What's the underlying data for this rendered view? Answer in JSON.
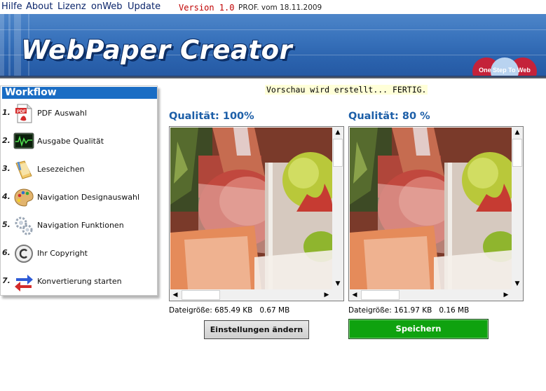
{
  "menu": {
    "items": [
      "Hilfe",
      "About",
      "Lizenz",
      "onWeb",
      "Update"
    ],
    "version": "Version 1.0",
    "edition_info": "PROF. vom 18.11.2009"
  },
  "banner": {
    "title": "WebPaper Creator",
    "partner_logo_text": "One Step To Web"
  },
  "workflow": {
    "title": "Workflow",
    "items": [
      {
        "num": "1.",
        "label": "PDF Auswahl",
        "icon": "pdf-icon"
      },
      {
        "num": "2.",
        "label": "Ausgabe Qualität",
        "icon": "monitor-chart-icon"
      },
      {
        "num": "3.",
        "label": "Lesezeichen",
        "icon": "bookmark-icon"
      },
      {
        "num": "4.",
        "label": "Navigation Designauswahl",
        "icon": "palette-icon"
      },
      {
        "num": "5.",
        "label": "Navigation Funktionen",
        "icon": "gears-icon"
      },
      {
        "num": "6.",
        "label": "Ihr Copyright",
        "icon": "copyright-icon"
      },
      {
        "num": "7.",
        "label": "Konvertierung starten",
        "icon": "convert-arrows-icon"
      }
    ]
  },
  "status": "Vorschau wird erstellt... FERTIG.",
  "preview_left": {
    "title": "Qualität: 100%",
    "filesize_label": "Dateigröße: 685.49 KB",
    "filesize_mb": "0.67 MB"
  },
  "preview_right": {
    "title": "Qualität: 80 %",
    "filesize_label": "Dateigröße: 161.97 KB",
    "filesize_mb": "0.16 MB"
  },
  "buttons": {
    "settings": "Einstellungen ändern",
    "save": "Speichern"
  },
  "colors": {
    "banner": "#2b63ae",
    "workflow_header": "#1a6dc4",
    "quality_title": "#1d5fa8",
    "version": "#c00000",
    "save_button": "#0fa20f"
  }
}
